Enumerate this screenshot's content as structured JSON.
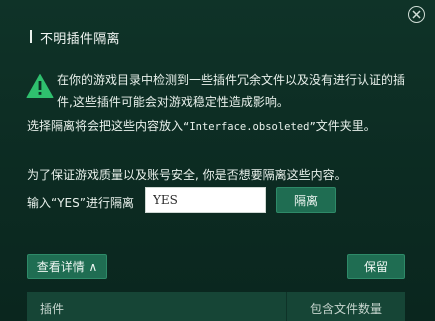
{
  "dialog": {
    "title": "不明插件隔离"
  },
  "warning": {
    "line1": "在你的游戏目录中检测到一些插件冗余文件以及没有进行认证的插",
    "line2": "件,这些插件可能会对游戏稳定性造成影响。"
  },
  "move_notice": {
    "prefix": "选择隔离将会把这些内容放入",
    "folder": "“Interface.obsoleted”",
    "suffix": "文件夹里。"
  },
  "confirm": {
    "prompt": "为了保证游戏质量以及账号安全, 你是否想要隔离这些内容。",
    "input_label": "输入“YES”进行隔离",
    "input_value": "YES"
  },
  "buttons": {
    "isolate": "隔离",
    "details": "查看详情 ∧",
    "keep": "保留"
  },
  "table": {
    "columns": [
      "插件",
      "包含文件数量"
    ]
  },
  "icons": {
    "warning": "warning-triangle-icon",
    "close": "close-circle-icon"
  },
  "colors": {
    "background": "#0d2e25",
    "button": "#1f6d52",
    "warning": "#2fbf6e"
  }
}
